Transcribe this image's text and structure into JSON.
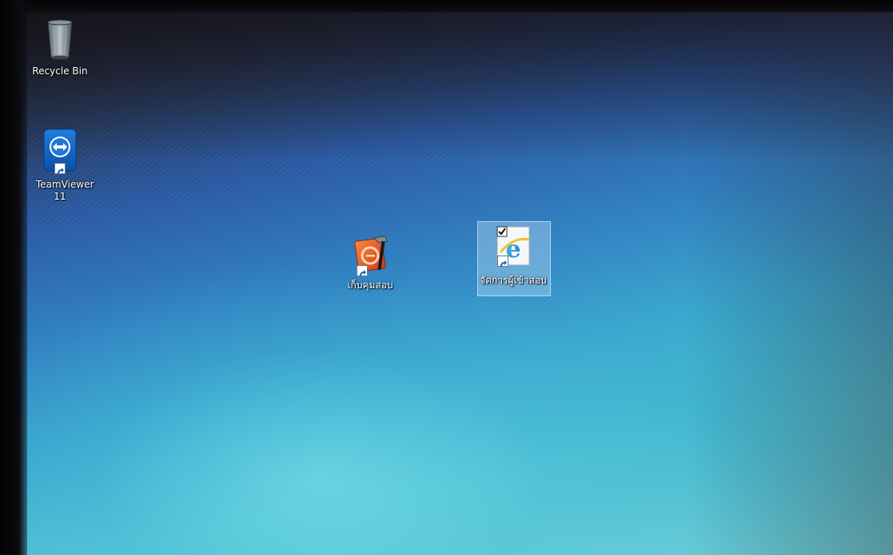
{
  "desktop": {
    "icons": [
      {
        "label": "Recycle Bin",
        "icon": "recycle-bin-icon"
      },
      {
        "label": "TeamViewer 11",
        "icon": "teamviewer-icon",
        "shortcut": true
      },
      {
        "label": "เก็บคุมสอบ",
        "icon": "ie-tools-icon",
        "shortcut": true
      },
      {
        "label": "จัดการผู้เข้าสอบ",
        "icon": "internet-explorer-icon",
        "shortcut": true,
        "selected": true
      }
    ]
  },
  "colors": {
    "wallpaper_top": "#24304a",
    "wallpaper_mid": "#2f7ec0",
    "wallpaper_bottom": "#6fd2d9",
    "label_text": "#ffffff",
    "selection": "#aad2f0"
  }
}
